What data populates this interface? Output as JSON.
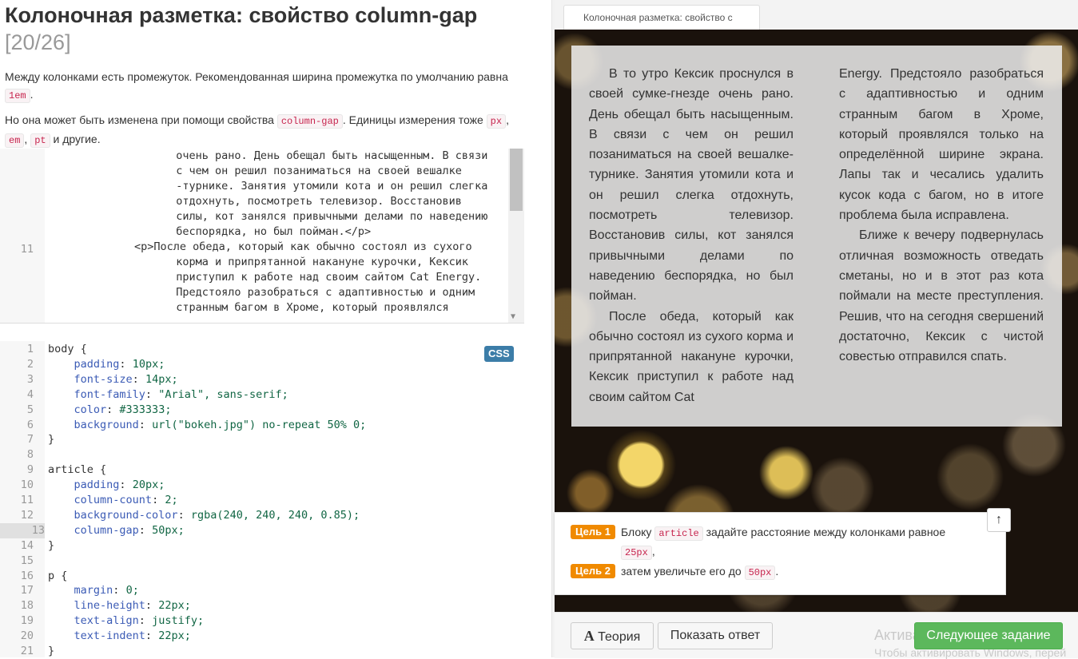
{
  "lesson": {
    "title": "Колоночная разметка: свойство column-gap",
    "counter": "[20/26]",
    "intro1_before": "Между колонками есть промежуток. Рекомендованная ширина промежутка по умолчанию равна",
    "intro1_code": "1em",
    "intro1_after": ".",
    "intro2_before": "Но она может быть изменена при помощи свойства",
    "intro2_code1": "column-gap",
    "intro2_mid": ". Единицы измерения тоже",
    "intro2_code2": "px",
    "intro2_sep1": ",",
    "intro2_code3": "em",
    "intro2_sep2": ",",
    "intro2_code4": "pt",
    "intro2_after": "и другие."
  },
  "html_editor": {
    "line_number": "11",
    "lines": [
      "  очень рано. День обещал быть насыщенным. В связи",
      "  с чем он решил позаниматься на своей вешалке",
      "  -турнике. Занятия утомили кота и он решил слегка",
      "  отдохнуть, посмотреть телевизор. Восстановив",
      "  силы, кот занялся привычными делами по наведению",
      "  беспорядка, но был пойман.</p>",
      "<p>После обеда, который как обычно состоял из сухого",
      "  корма и припрятанной накануне курочки, Кексик",
      "  приступил к работе над своим сайтом Cat Energy.",
      "  Предстояло разобраться с адаптивностью и одним",
      "  странным багом в Хроме, который проявлялся"
    ]
  },
  "css_editor": {
    "badge": "CSS",
    "lines": [
      {
        "n": "1",
        "t": "body {"
      },
      {
        "n": "2",
        "t": "    padding: 10px;"
      },
      {
        "n": "3",
        "t": "    font-size: 14px;"
      },
      {
        "n": "4",
        "t": "    font-family: \"Arial\", sans-serif;"
      },
      {
        "n": "5",
        "t": "    color: #333333;"
      },
      {
        "n": "6",
        "t": "    background: url(\"bokeh.jpg\") no-repeat 50% 0;"
      },
      {
        "n": "7",
        "t": "}"
      },
      {
        "n": "8",
        "t": ""
      },
      {
        "n": "9",
        "t": "article {"
      },
      {
        "n": "10",
        "t": "    padding: 20px;"
      },
      {
        "n": "11",
        "t": "    column-count: 2;"
      },
      {
        "n": "12",
        "t": "    background-color: rgba(240, 240, 240, 0.85);"
      },
      {
        "n": "13",
        "t": "    column-gap: 50px;"
      },
      {
        "n": "14",
        "t": "}"
      },
      {
        "n": "15",
        "t": ""
      },
      {
        "n": "16",
        "t": "p {"
      },
      {
        "n": "17",
        "t": "    margin: 0;"
      },
      {
        "n": "18",
        "t": "    line-height: 22px;"
      },
      {
        "n": "19",
        "t": "    text-align: justify;"
      },
      {
        "n": "20",
        "t": "    text-indent: 22px;"
      },
      {
        "n": "21",
        "t": "}"
      }
    ]
  },
  "preview": {
    "tab_title": "Колоночная разметка: свойство с",
    "col1_p1": "В то утро Кексик проснулся в своей сумке-гнезде очень рано. День обещал быть насыщенным. В связи с чем он решил позаниматься на своей вешалке-турнике. Занятия утомили кота и он решил слегка отдохнуть, посмотреть телевизор. Восстановив силы, кот занялся привычными делами по наведению беспорядка, но был пойман.",
    "col1_p2": "После обеда, который как обычно состоял из сухого корма и припрятанной накануне курочки, Кексик приступил к работе над своим сайтом Cat",
    "col2_p2cont": "Energy. Предстояло разобраться с адаптивностью и одним странным багом в Хроме, который проявлялся только на определённой ширине экрана. Лапы так и чесались удалить кусок кода с багом, но в итоге проблема была исправлена.",
    "col2_p3": "Ближе к вечеру подвернулась отличная возможность отведать сметаны, но и в этот раз кота поймали на месте преступления. Решив, что на сегодня свершений достаточно, Кексик с чистой совестью отправился спать."
  },
  "tasks": {
    "goal1_label": "Цель 1",
    "goal1_before": "Блоку",
    "goal1_code": "article",
    "goal1_mid": "задайте расстояние между колонками равное",
    "goal1_code2": "25px",
    "goal1_after": ",",
    "goal2_label": "Цель 2",
    "goal2_before": "затем увеличьте его до",
    "goal2_code": "50px",
    "goal2_after": ".",
    "arrow_icon": "↑"
  },
  "buttons": {
    "theory": "Теория",
    "theory_icon": "A",
    "show_answer": "Показать ответ",
    "next_task": "Следующее задание"
  },
  "watermark": {
    "line1": "Активация Windows",
    "line2": "Чтобы активировать Windows, перей"
  },
  "colors": {
    "accent_orange": "#f08a00",
    "green_button": "#5cb85c",
    "css_badge": "#3c7da8"
  }
}
